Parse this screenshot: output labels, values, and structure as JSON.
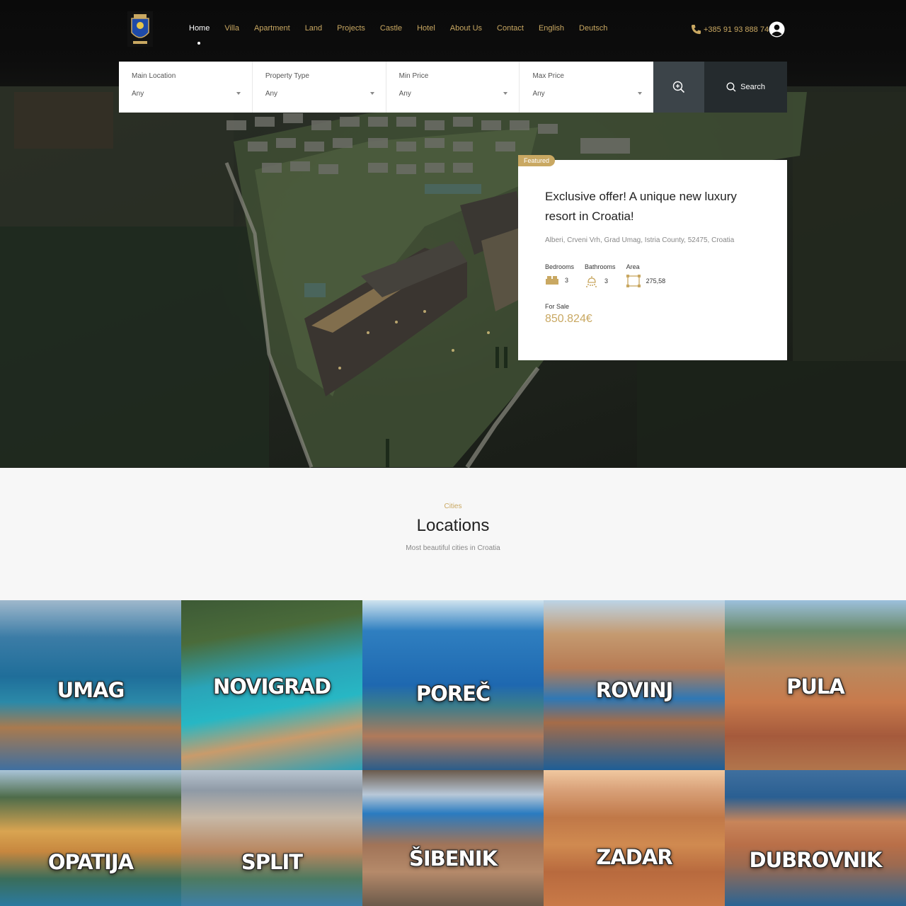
{
  "nav": {
    "items": [
      "Home",
      "Villa",
      "Apartment",
      "Land",
      "Projects",
      "Castle",
      "Hotel",
      "About Us",
      "Contact",
      "English",
      "Deutsch"
    ],
    "active": "Home",
    "phone": "+385 91 93 888 74"
  },
  "search": {
    "fields": [
      {
        "label": "Main Location",
        "value": "Any"
      },
      {
        "label": "Property Type",
        "value": "Any"
      },
      {
        "label": "Min Price",
        "value": "Any"
      },
      {
        "label": "Max Price",
        "value": "Any"
      }
    ],
    "button_label": "Search"
  },
  "featured": {
    "badge": "Featured",
    "title": "Exclusive offer! A unique new luxury resort in Croatia!",
    "address": "Alberi, Crveni Vrh, Grad Umag, Istria County, 52475, Croatia",
    "specs": [
      {
        "label": "Bedrooms",
        "value": "3",
        "icon": "bed-icon"
      },
      {
        "label": "Bathrooms",
        "value": "3",
        "icon": "shower-icon"
      },
      {
        "label": "Area",
        "value": "275,58",
        "icon": "area-icon"
      }
    ],
    "status": "For Sale",
    "price": "850.824€"
  },
  "locations": {
    "subtitle": "Cities",
    "title": "Locations",
    "description": "Most beautiful cities in Croatia",
    "cities": [
      "UMAG",
      "NOVIGRAD",
      "POREČ",
      "ROVINJ",
      "PULA",
      "OPATIJA",
      "SPLIT",
      "ŠIBENIK",
      "ZADAR",
      "DUBROVNIK"
    ]
  },
  "colors": {
    "accent": "#c9a862",
    "dark": "#0d0d0d",
    "search_adv": "#3c4449",
    "search_btn": "#252b2e"
  }
}
